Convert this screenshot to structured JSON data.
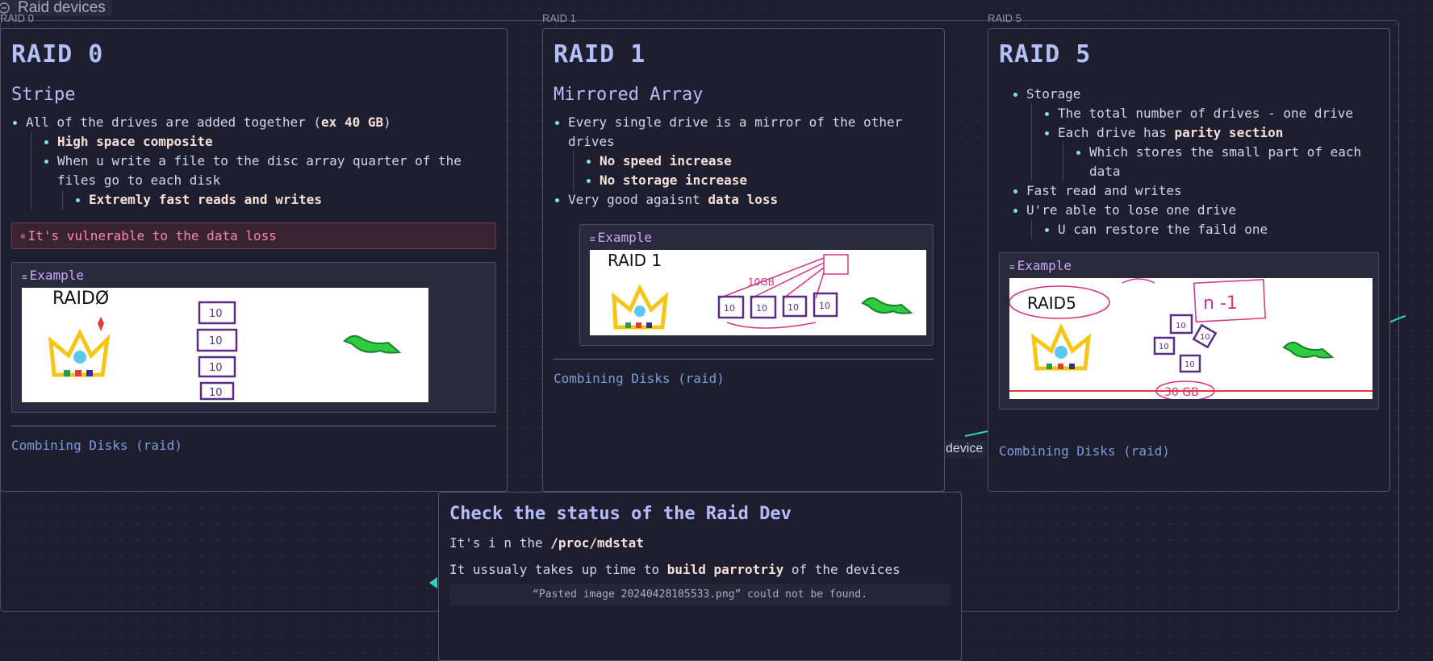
{
  "group": {
    "title": "Raid devices"
  },
  "raid0": {
    "label": "RAID 0",
    "heading": "RAID 0",
    "subheading": "Stripe",
    "bullet1_text": "All of the drives are added together (",
    "bullet1_bold": "ex 40 GB",
    "bullet1_end": ")",
    "sub1": "High space composite",
    "sub2": "When u write a file to the disc array quarter of the files go to each disk",
    "subsub1": "Extremly fast reads and writes",
    "callout": "It's vulnerable to the data loss",
    "example_title": "Example",
    "link": "Combining Disks (raid)"
  },
  "raid1": {
    "label": "RAID 1",
    "heading": "RAID 1",
    "subheading": "Mirrored Array",
    "bullet1": "Every single drive is a mirror of the other drives",
    "sub1": "No speed increase",
    "sub2": "No storage increase",
    "bullet2_text": "Very good agaisnt ",
    "bullet2_bold": "data loss",
    "example_title": "Example",
    "link": "Combining Disks (raid)"
  },
  "raid5": {
    "label": "RAID 5",
    "heading": "RAID 5",
    "bullet1": "Storage",
    "sub1": "The total number of drives - one drive",
    "sub2_text": "Each drive has ",
    "sub2_bold": "parity section",
    "subsub1": "Which stores the small part of each data",
    "bullet2": "Fast read and writes",
    "bullet3": "U're able to lose one drive",
    "sub3": "U can restore the faild one",
    "example_title": "Example",
    "link": "Combining Disks (raid)"
  },
  "edge_label": "device",
  "status": {
    "heading": "Check the status of the Raid Dev",
    "line1_text": "It's i n the ",
    "line1_bold": "/proc/mdstat",
    "line2_text": "It ussualy takes up time to ",
    "line2_bold": "build parrotriy",
    "line2_end": " of the devices",
    "missing_image": "“Pasted image 20240428105533.png” could not be found."
  },
  "sketches": {
    "raid0_caption": "RAIDØ",
    "raid1_caption": "RAID 1",
    "raid1_size": "10GB",
    "raid5_caption": "RAID5",
    "raid5_formula": "n -1",
    "raid5_size": "30 GB",
    "disk_label": "10"
  },
  "colors": {
    "accent": "#b4befe",
    "danger": "#f38ba8",
    "link": "#89b4fa",
    "bullet": "#89dceb"
  }
}
